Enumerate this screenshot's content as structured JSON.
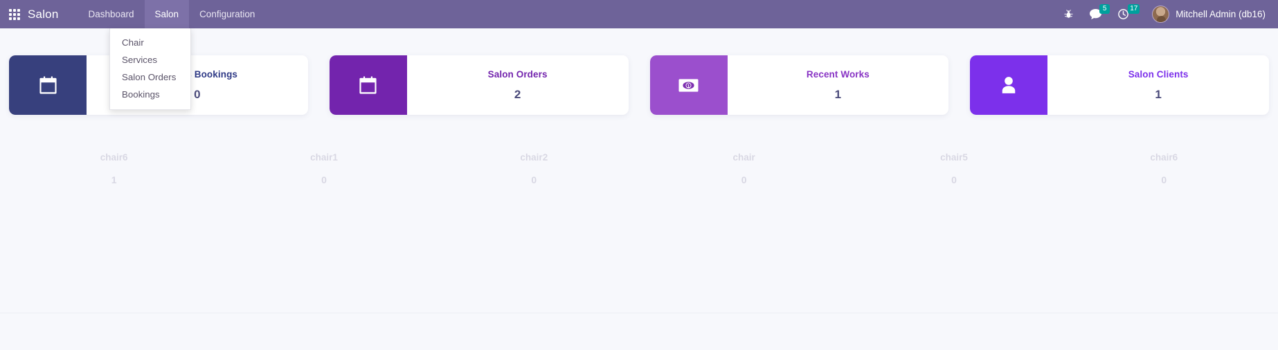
{
  "navbar": {
    "apps_icon": "apps-grid-icon",
    "brand": "Salon",
    "menu": [
      {
        "label": "Dashboard",
        "active": false
      },
      {
        "label": "Salon",
        "active": true
      },
      {
        "label": "Configuration",
        "active": false
      }
    ],
    "sys_icons": [
      {
        "name": "bug-icon",
        "badge": null
      },
      {
        "name": "messages-icon",
        "badge": "5"
      },
      {
        "name": "activities-clock-icon",
        "badge": "17"
      }
    ],
    "user": "Mitchell Admin (db16)",
    "accent_bg": "#6e6399",
    "badge_color": "#00a09d"
  },
  "dropdown": {
    "open": true,
    "items": [
      "Chair",
      "Services",
      "Salon Orders",
      "Bookings"
    ]
  },
  "cards": [
    {
      "title": "Today's Bookings",
      "value": "0",
      "icon": "calendar-icon",
      "icon_bg": "#37407d",
      "title_color": "#2f3a86"
    },
    {
      "title": "Salon Orders",
      "value": "2",
      "icon": "calendar-icon",
      "icon_bg": "#7324ad",
      "title_color": "#7324ad"
    },
    {
      "title": "Recent Works",
      "value": "1",
      "icon": "banknote-icon",
      "icon_bg": "#9b4fcd",
      "title_color": "#8833c4"
    },
    {
      "title": "Salon Clients",
      "value": "1",
      "icon": "user-icon",
      "icon_bg": "#7c30eb",
      "title_color": "#7c30eb"
    }
  ],
  "chairs": [
    {
      "name": "chair6",
      "value": "1"
    },
    {
      "name": "chair1",
      "value": "0"
    },
    {
      "name": "chair2",
      "value": "0"
    },
    {
      "name": "chair",
      "value": "0"
    },
    {
      "name": "chair5",
      "value": "0"
    },
    {
      "name": "chair6",
      "value": "0"
    }
  ]
}
